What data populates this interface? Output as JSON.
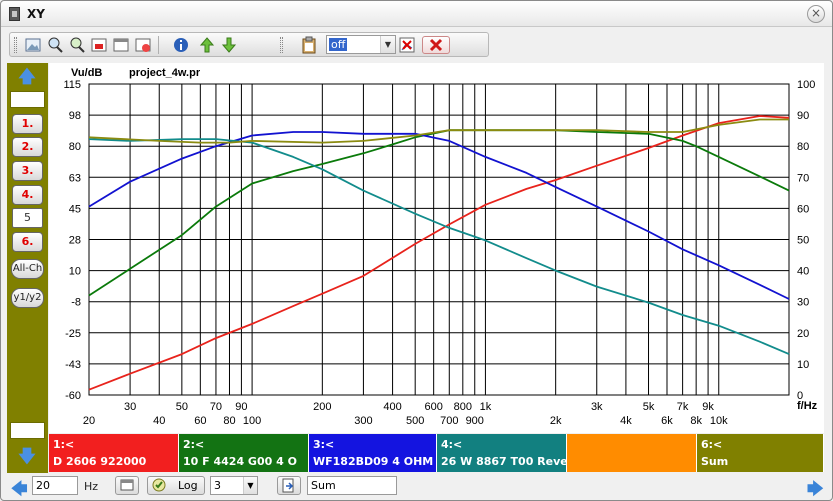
{
  "window": {
    "title": "XY",
    "close_glyph": "×"
  },
  "toolbar": {
    "combo_value": "off",
    "icons": [
      "image-icon",
      "zoom-icon",
      "zoom-reset-icon",
      "window-red-icon",
      "window-icon",
      "window-add-icon",
      "info-icon",
      "arrow-up-green-icon",
      "arrow-down-green-icon",
      "clipboard-icon",
      "delete-chart-icon",
      "delete-icon"
    ]
  },
  "sidebar": {
    "buttons": [
      "1.",
      "2.",
      "3.",
      "4.",
      "5",
      "6.",
      "All-Ch",
      "y1/y2"
    ]
  },
  "chart_data": {
    "type": "line",
    "file_label": "project_4w.pr",
    "ylabel": "Vu/dB",
    "xlabel": "f/Hz",
    "xscale": "log",
    "xlim": [
      20,
      20000
    ],
    "ylim": [
      -60,
      115
    ],
    "y2lim": [
      0,
      100
    ],
    "grid": true,
    "x_tick_labels": [
      {
        "f": 20,
        "label": "20",
        "row": 2
      },
      {
        "f": 30,
        "label": "30",
        "row": 1
      },
      {
        "f": 40,
        "label": "40",
        "row": 2
      },
      {
        "f": 50,
        "label": "50",
        "row": 1
      },
      {
        "f": 60,
        "label": "60",
        "row": 2
      },
      {
        "f": 70,
        "label": "70",
        "row": 1
      },
      {
        "f": 80,
        "label": "80",
        "row": 2
      },
      {
        "f": 90,
        "label": "90",
        "row": 1
      },
      {
        "f": 100,
        "label": "100",
        "row": 2
      },
      {
        "f": 200,
        "label": "200",
        "row": 1
      },
      {
        "f": 300,
        "label": "300",
        "row": 2
      },
      {
        "f": 400,
        "label": "400",
        "row": 1
      },
      {
        "f": 500,
        "label": "500",
        "row": 2
      },
      {
        "f": 600,
        "label": "600",
        "row": 1
      },
      {
        "f": 700,
        "label": "700",
        "row": 2
      },
      {
        "f": 800,
        "label": "800",
        "row": 1
      },
      {
        "f": 900,
        "label": "900",
        "row": 2
      },
      {
        "f": 1000,
        "label": "1k",
        "row": 1
      },
      {
        "f": 2000,
        "label": "2k",
        "row": 2
      },
      {
        "f": 3000,
        "label": "3k",
        "row": 1
      },
      {
        "f": 4000,
        "label": "4k",
        "row": 2
      },
      {
        "f": 5000,
        "label": "5k",
        "row": 1
      },
      {
        "f": 6000,
        "label": "6k",
        "row": 2
      },
      {
        "f": 7000,
        "label": "7k",
        "row": 1
      },
      {
        "f": 8000,
        "label": "8k",
        "row": 2
      },
      {
        "f": 9000,
        "label": "9k",
        "row": 1
      },
      {
        "f": 10000,
        "label": "10k",
        "row": 2
      }
    ],
    "y_tick_labels": [
      "115",
      "98",
      "80",
      "63",
      "45",
      "28",
      "10",
      "-8",
      "-25",
      "-43",
      "-60"
    ],
    "y_tick_values": [
      115,
      97.5,
      80,
      62.5,
      45,
      27.5,
      10,
      -7.5,
      -25,
      -42.5,
      -60
    ],
    "y2_tick_labels": [
      "100",
      "90",
      "80",
      "70",
      "60",
      "50",
      "40",
      "30",
      "20",
      "10",
      "0"
    ],
    "series": [
      {
        "color": "#e8231c",
        "x": [
          20,
          30,
          50,
          70,
          100,
          150,
          200,
          300,
          500,
          700,
          1000,
          1500,
          2000,
          3000,
          5000,
          7000,
          10000,
          15000,
          20000
        ],
        "y": [
          -57,
          -48,
          -37,
          -28,
          -20,
          -10,
          -3,
          7,
          25,
          36,
          47,
          56,
          61,
          69,
          79,
          86,
          93,
          97,
          96
        ]
      },
      {
        "color": "#0a7a0a",
        "x": [
          20,
          30,
          50,
          70,
          100,
          150,
          200,
          300,
          400,
          500,
          700,
          1000,
          1500,
          2000,
          3000,
          5000,
          7000,
          8000,
          10000,
          15000,
          20000
        ],
        "y": [
          -4,
          11,
          30,
          46,
          59,
          66,
          70,
          76,
          81,
          85,
          89,
          89,
          89,
          89,
          88,
          87,
          83,
          80,
          74,
          63,
          55
        ]
      },
      {
        "color": "#1212d0",
        "x": [
          20,
          30,
          50,
          70,
          100,
          150,
          200,
          300,
          500,
          700,
          1000,
          1500,
          2000,
          3000,
          5000,
          7000,
          10000,
          15000,
          20000
        ],
        "y": [
          46,
          60,
          73,
          80,
          86,
          88,
          88,
          87,
          87,
          83,
          74,
          65,
          57,
          46,
          32,
          22,
          13,
          2,
          -6
        ]
      },
      {
        "color": "#128c8c",
        "x": [
          20,
          30,
          50,
          70,
          100,
          150,
          200,
          300,
          500,
          700,
          1000,
          1500,
          2000,
          3000,
          5000,
          7000,
          10000,
          15000,
          20000
        ],
        "y": [
          84,
          83,
          84,
          84,
          82,
          74,
          67,
          55,
          42,
          34,
          27,
          17,
          10,
          1,
          -8,
          -15,
          -21,
          -30,
          -37
        ]
      },
      {
        "color": "#8b8b10",
        "x": [
          20,
          40,
          60,
          80,
          100,
          200,
          300,
          500,
          700,
          1000,
          1500,
          2000,
          3000,
          5000,
          7000,
          10000,
          15000,
          20000
        ],
        "y": [
          85,
          83,
          82,
          82,
          83,
          82,
          83,
          86,
          89,
          89,
          89,
          89,
          89,
          88,
          88,
          92,
          95,
          95
        ]
      }
    ]
  },
  "channels": [
    {
      "line1": "1:<",
      "line2": "D 2606 922000",
      "color": "#f21f1f"
    },
    {
      "line1": "2:<",
      "line2": "10 F 4424 G00  4 O",
      "color": "#137313"
    },
    {
      "line1": "3:<",
      "line2": "WF182BD09  4 OHM",
      "color": "#1414e0"
    },
    {
      "line1": "4:<",
      "line2": "26 W 8867 T00 Reve",
      "color": "#128080"
    },
    {
      "line1": "",
      "line2": "",
      "color": "#ff8c00"
    },
    {
      "line1": "6:<",
      "line2": "Sum",
      "color": "#808000"
    }
  ],
  "status": {
    "freq_value": "20",
    "freq_unit": "Hz",
    "log_label": "Log",
    "num_value": "3",
    "sum_value": "Sum"
  }
}
